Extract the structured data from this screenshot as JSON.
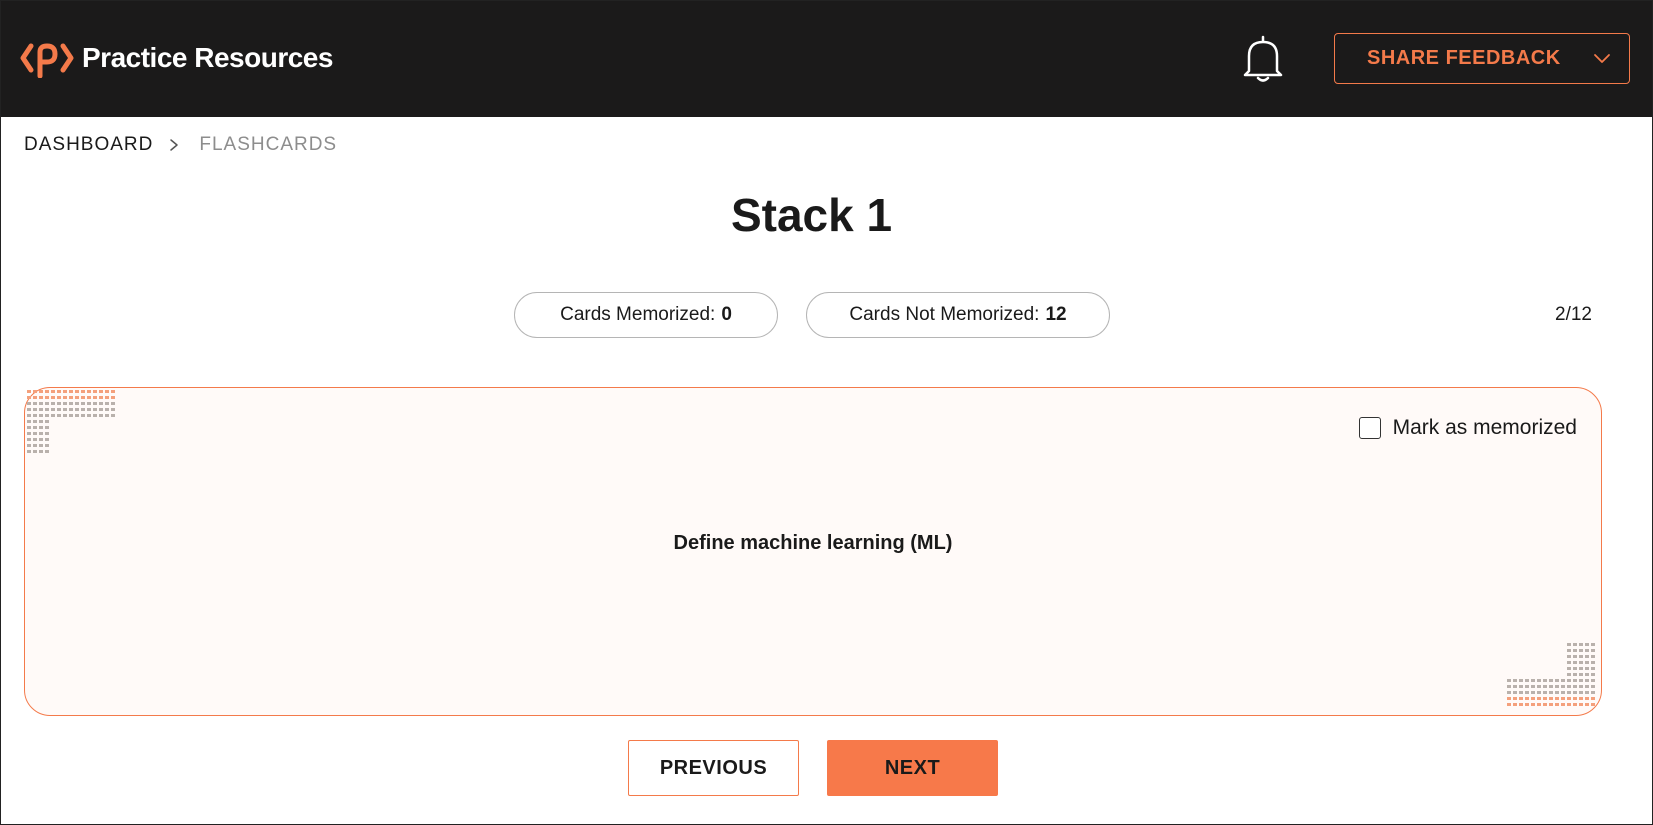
{
  "header": {
    "app_name": "Practice Resources",
    "feedback_label": "SHARE FEEDBACK"
  },
  "breadcrumb": {
    "home": "DASHBOARD",
    "current": "FLASHCARDS"
  },
  "page": {
    "title": "Stack 1"
  },
  "stats": {
    "memorized_label": "Cards Memorized:",
    "memorized_count": "0",
    "not_memorized_label": "Cards Not Memorized:",
    "not_memorized_count": "12",
    "position": "2/12"
  },
  "card": {
    "mark_label": "Mark as memorized",
    "mark_checked": false,
    "question": "Define machine learning (ML)"
  },
  "nav": {
    "previous_label": "PREVIOUS",
    "next_label": "NEXT"
  },
  "colors": {
    "accent": "#f47a4a",
    "header_bg": "#1b1a1a",
    "card_bg": "#fffaf8"
  },
  "icons": {
    "logo": "brand-logo-icon",
    "notifications": "bell-icon",
    "dropdown": "chevron-down-icon",
    "breadcrumb_separator": "chevron-right-icon"
  }
}
